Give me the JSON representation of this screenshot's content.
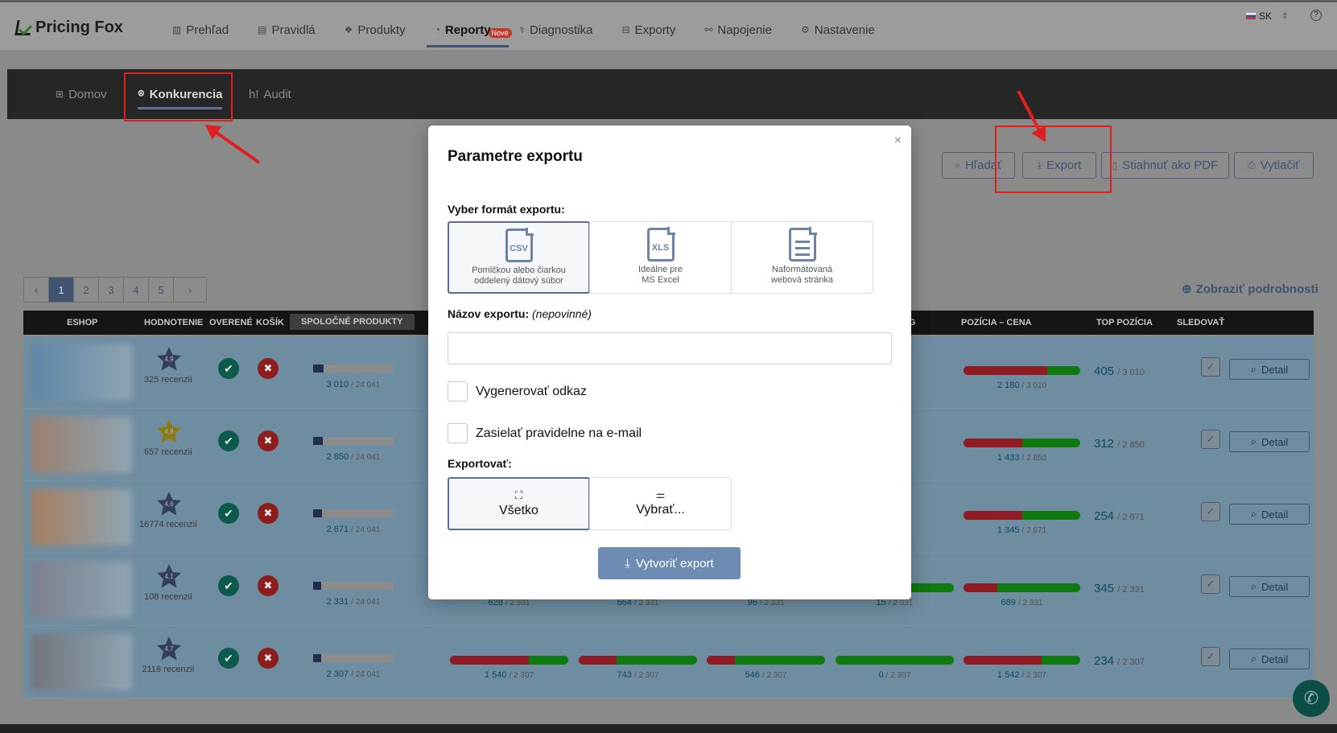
{
  "app": {
    "logo_text": "Pricing Fox",
    "language": "SK",
    "help_label": "?"
  },
  "main_nav": [
    {
      "label": "Prehľad",
      "icon": "bar-chart-icon"
    },
    {
      "label": "Pravidlá",
      "icon": "list-icon"
    },
    {
      "label": "Produkty",
      "icon": "cubes-icon"
    },
    {
      "label": "Reporty",
      "icon": "pie-chart-icon",
      "active": true,
      "badge": "Nové"
    },
    {
      "label": "Diagnostika",
      "icon": "stethoscope-icon"
    },
    {
      "label": "Exporty",
      "icon": "inbox-icon"
    },
    {
      "label": "Napojenie",
      "icon": "share-icon"
    },
    {
      "label": "Nastavenie",
      "icon": "gear-icon"
    }
  ],
  "sub_nav": [
    {
      "label": "Domov",
      "icon": "grid-icon"
    },
    {
      "label": "Konkurencia",
      "icon": "users-icon",
      "active": true
    },
    {
      "label": "Audit",
      "icon": "audit-icon",
      "icon_text": "h!"
    }
  ],
  "toolbar": {
    "search_label": "Hľadať",
    "export_label": "Export",
    "pdf_label": "Stiahnuť ako PDF",
    "print_label": "Vytlačiť"
  },
  "pagination": {
    "prev": "‹",
    "pages": [
      "1",
      "2",
      "3",
      "4",
      "5"
    ],
    "current": "1",
    "next": "›"
  },
  "show_details": "Zobraziť podrobnosti",
  "table": {
    "headers": {
      "eshop": "ESHOP",
      "rating": "HODNOTENIE",
      "verified": "OVERENÉ",
      "cart": "KOŠÍK",
      "common": "SPOLOČNÉ PRODUKTY",
      "col_g": "G",
      "pos_price": "POZÍCIA – CENA",
      "top_pos": "TOP POZÍCIA",
      "follow": "SLEDOVAŤ"
    },
    "detail_label": "Detail",
    "rows": [
      {
        "rating": "4,9",
        "reviews": "325 recenzií",
        "common": "3 010",
        "total": "24 041",
        "common_ratio": 0.125,
        "bars": [
          {
            "v": "",
            "t": "",
            "r": 0.0
          },
          {
            "v": "",
            "t": "",
            "r": 0.0
          },
          {
            "v": "",
            "t": "",
            "r": 0.0
          },
          {
            "v": "",
            "t": "",
            "r": 0.0
          },
          {
            "v": "2 180",
            "t": "3 010",
            "r": 0.72
          }
        ],
        "top": "405",
        "top_total": "3 010",
        "thumb": "#5e86a8"
      },
      {
        "rating": "4,8",
        "reviews": "657 recenzií",
        "common": "2 850",
        "total": "24 041",
        "common_ratio": 0.118,
        "bars": [
          {
            "v": "",
            "t": "",
            "r": 0.0
          },
          {
            "v": "",
            "t": "",
            "r": 0.0
          },
          {
            "v": "",
            "t": "",
            "r": 0.0
          },
          {
            "v": "",
            "t": "",
            "r": 0.0
          },
          {
            "v": "1 433",
            "t": "2 850",
            "r": 0.5
          }
        ],
        "top": "312",
        "top_total": "2 850",
        "thumb": "#9a7f6e",
        "gold": true
      },
      {
        "rating": "4,6",
        "reviews": "16774 recenzií",
        "common": "2 671",
        "total": "24 041",
        "common_ratio": 0.11,
        "bars": [
          {
            "v": "",
            "t": "",
            "r": 0.0
          },
          {
            "v": "",
            "t": "",
            "r": 0.0
          },
          {
            "v": "",
            "t": "",
            "r": 0.0
          },
          {
            "v": "",
            "t": "",
            "r": 0.0
          },
          {
            "v": "1 345",
            "t": "2 671",
            "r": 0.5
          }
        ],
        "top": "254",
        "top_total": "2 671",
        "thumb": "#a57e62"
      },
      {
        "rating": "4,1",
        "reviews": "108 recenzií",
        "common": "2 331",
        "total": "24 041",
        "common_ratio": 0.097,
        "bars": [
          {
            "v": "628",
            "t": "2 331",
            "r": 0.0
          },
          {
            "v": "664",
            "t": "2 331",
            "r": 0.0
          },
          {
            "v": "96",
            "t": "2 331",
            "r": 0.0
          },
          {
            "v": "15",
            "t": "2 331",
            "r": 0.0
          },
          {
            "v": "689",
            "t": "2 331",
            "r": 0.29
          }
        ],
        "top": "345",
        "top_total": "2 331",
        "thumb": "#7c7f8e"
      },
      {
        "rating": "4,7",
        "reviews": "2118 recenzií",
        "common": "2 307",
        "total": "24 041",
        "common_ratio": 0.096,
        "bars": [
          {
            "v": "1 540",
            "t": "2 307",
            "r": 0.67
          },
          {
            "v": "743",
            "t": "2 307",
            "r": 0.32
          },
          {
            "v": "546",
            "t": "2 307",
            "r": 0.24
          },
          {
            "v": "0",
            "t": "2 307",
            "r": 0.0
          },
          {
            "v": "1 542",
            "t": "2 307",
            "r": 0.67
          }
        ],
        "top": "234",
        "top_total": "2 307",
        "thumb": "#72757c"
      }
    ]
  },
  "modal": {
    "title": "Parametre exportu",
    "close": "×",
    "format_label": "Vyber formát exportu:",
    "formats": [
      {
        "code": "CSV",
        "line1": "Pomlčkou alebo čiarkou",
        "line2": "oddelený dátový súbor",
        "selected": true
      },
      {
        "code": "XLS",
        "line1": "Ideálne pre",
        "line2": "MS Excel",
        "selected": false
      },
      {
        "code": "",
        "line1": "Naformátovaná",
        "line2": "webová stránka",
        "selected": false
      }
    ],
    "name_label": "Názov exportu:",
    "name_optional": "(nepovinné)",
    "name_value": "",
    "generate_link": "Vygenerovať odkaz",
    "send_email": "Zasielať pravidelne na e-mail",
    "export_label": "Exportovať:",
    "export_all": "Všetko",
    "export_select": "Vybrať...",
    "create_button": "Vytvoriť export"
  },
  "colors": {
    "accent": "#3f5373",
    "primary_button": "#6d8bb3",
    "annotation_red": "#e02020"
  }
}
